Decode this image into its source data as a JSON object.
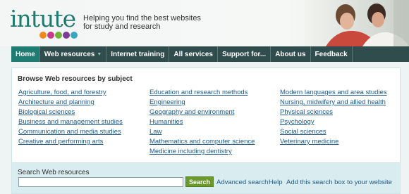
{
  "brand": {
    "logo_text": "intute",
    "tagline_line1": "Helping you find the best websites",
    "tagline_line2": "for study and research",
    "dot_colors": [
      "#f28a1b",
      "#c43c8a",
      "#6fb53a",
      "#7a3c98",
      "#3aa7c2"
    ]
  },
  "nav": {
    "items": [
      {
        "label": "Home",
        "active": true
      },
      {
        "label": "Web resources",
        "has_dropdown": true
      },
      {
        "label": "Internet training"
      },
      {
        "label": "All services"
      },
      {
        "label": "Support for..."
      },
      {
        "label": "About us"
      },
      {
        "label": "Feedback"
      }
    ]
  },
  "browse": {
    "title": "Browse Web resources by subject",
    "col1": [
      "Agriculture, food, and forestry",
      "Architecture and planning",
      "Biological sciences",
      "Business and management studies",
      "Communication and media studies",
      "Creative and performing arts"
    ],
    "col2": [
      "Education and research methods",
      "Engineering",
      "Geography and environment",
      "Humanities",
      "Law",
      "Mathematics and computer science",
      "Medicine including dentistry"
    ],
    "col3": [
      "Modern languages and area studies",
      "Nursing, midwifery and allied health",
      "Physical sciences",
      "Psychology",
      "Social sciences",
      "Veterinary medicine"
    ]
  },
  "search": {
    "title": "Search Web resources",
    "input_value": "",
    "button_label": "Search",
    "advanced_link": "Advanced search",
    "help_link": "Help",
    "add_link": "Add this search box to your website"
  },
  "colors": {
    "nav_bg": "#2f4d4c",
    "nav_active": "#1e7c72",
    "link": "#1f5a88",
    "search_button": "#6a9a2a"
  }
}
